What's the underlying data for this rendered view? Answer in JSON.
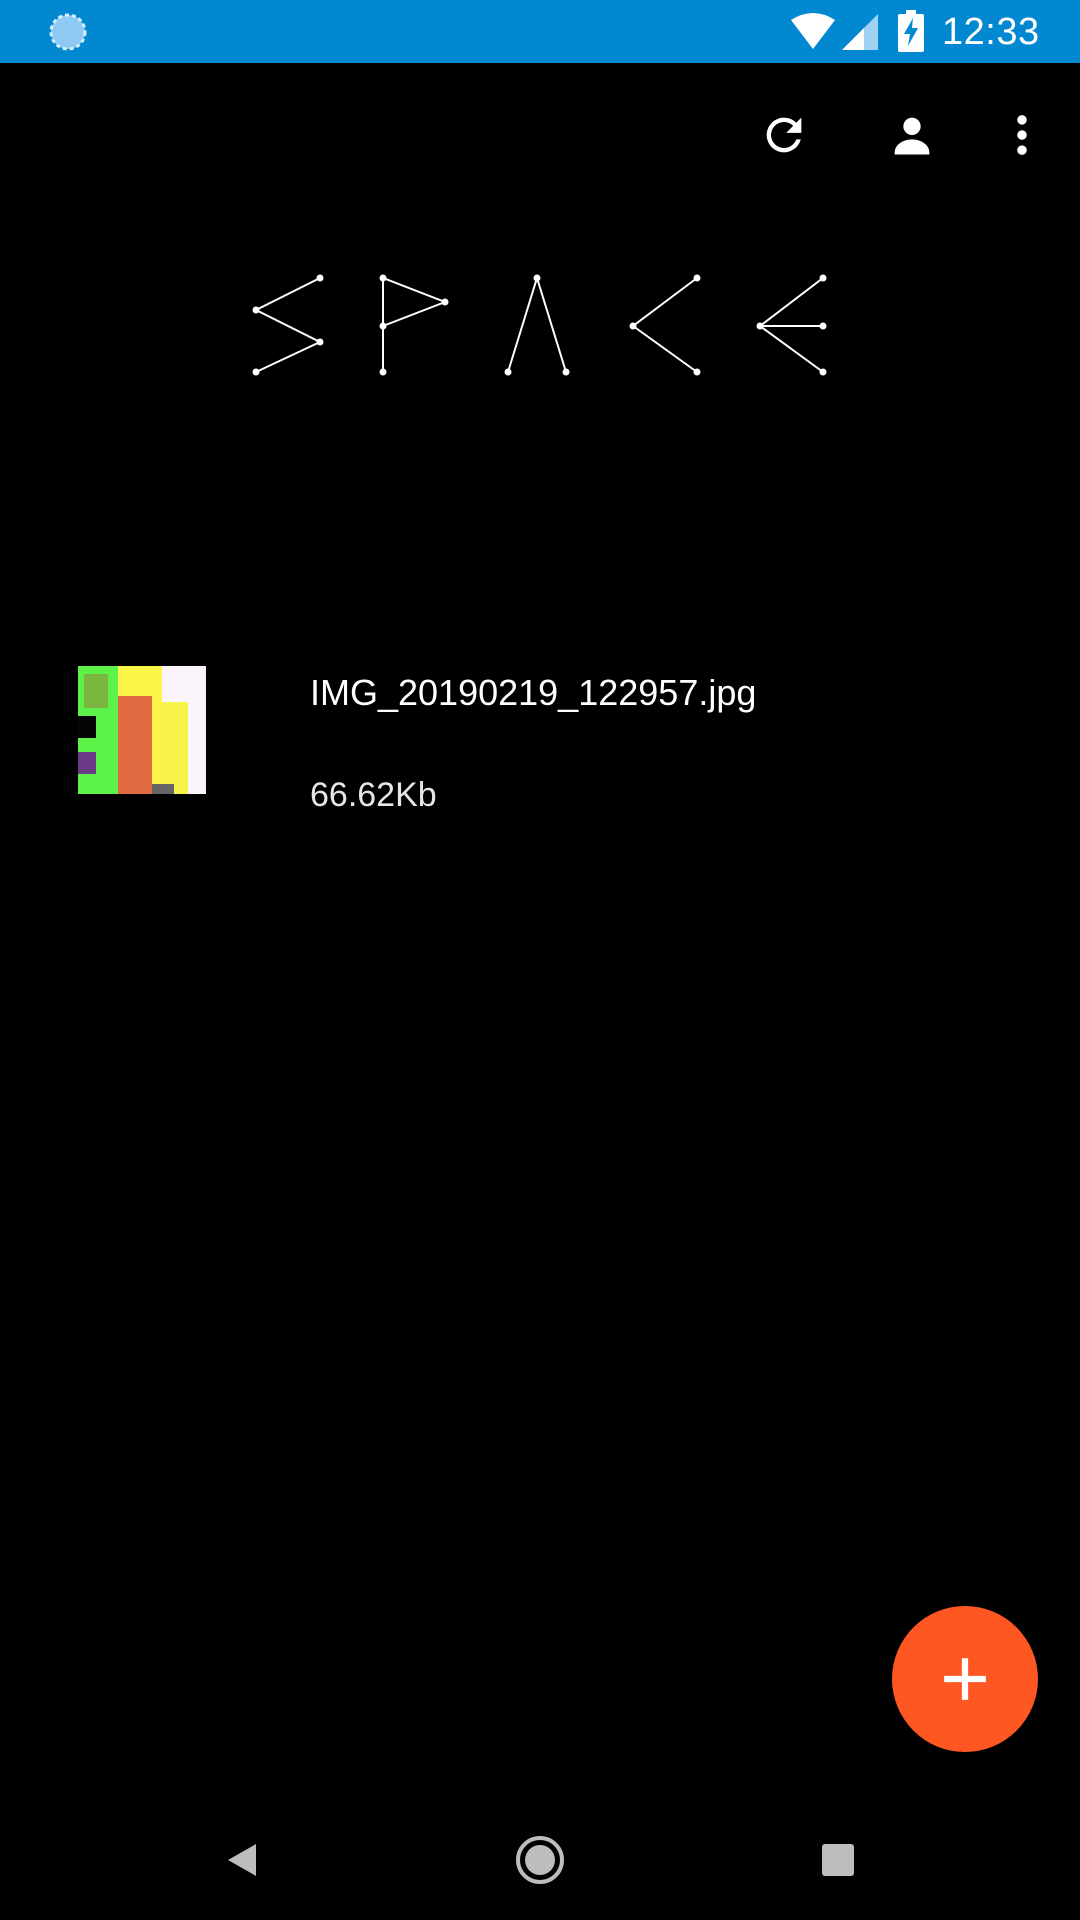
{
  "status_bar": {
    "time": "12:33",
    "icons": [
      "sync-icon",
      "wifi-icon",
      "signal-icon",
      "battery-charging-icon"
    ],
    "background": "#0288d1"
  },
  "toolbar": {
    "actions": [
      "refresh-icon",
      "account-icon",
      "more-vert-icon"
    ]
  },
  "logo": {
    "text": "SPACE"
  },
  "files": [
    {
      "name": "IMG_20190219_122957.jpg",
      "size": "66.62Kb",
      "thumbnail": "image-thumbnail"
    }
  ],
  "fab": {
    "icon": "add-icon",
    "color": "#ff5722"
  },
  "nav_bar": {
    "icons": [
      "back-icon",
      "home-icon",
      "recents-icon"
    ]
  }
}
